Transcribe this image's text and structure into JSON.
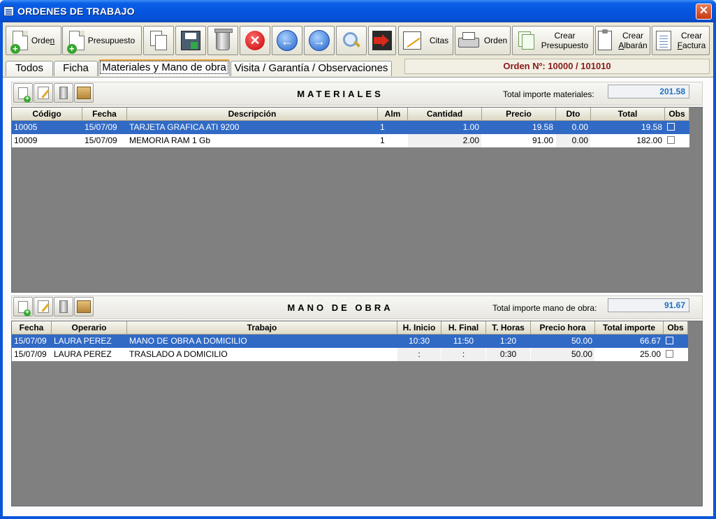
{
  "window": {
    "title": "ORDENES DE TRABAJO"
  },
  "toolbar": {
    "orden_label_pre": "Orde",
    "orden_label_u": "n",
    "presupuesto_label": "Presupuesto",
    "citas_label": "Citas",
    "print_orden_label": "Orden",
    "crear_presupuesto_l1": "Crear",
    "crear_presupuesto_l2": "Presupuesto",
    "crear_albaran_l1": "Crear",
    "crear_albaran_u": "A",
    "crear_albaran_rest": "lbarán",
    "crear_factura_l1": "Crear",
    "crear_factura_u": "F",
    "crear_factura_rest": "actura",
    "icons": [
      "new-order-icon",
      "new-budget-icon",
      "copy-icon",
      "save-icon",
      "trash-icon",
      "cancel-icon",
      "arrow-left-icon",
      "arrow-right-icon",
      "search-icon",
      "exit-icon",
      "calendar-icon",
      "printer-icon",
      "sheets-icon",
      "clipboard-icon",
      "invoice-icon"
    ]
  },
  "tabs": [
    "Todos",
    "Ficha",
    "Materiales y Mano de obra",
    "Visita / Garantía / Observaciones"
  ],
  "active_tab": "Materiales y Mano de obra",
  "order_number": "Orden Nº: 10000 / 101010",
  "materiales": {
    "title": "MATERIALES",
    "total_label": "Total importe materiales:",
    "total_value": "201.58",
    "columns": [
      "Código",
      "Fecha",
      "Descripción",
      "Alm",
      "Cantidad",
      "Precio",
      "Dto",
      "Total",
      "Obs"
    ],
    "rows": [
      {
        "codigo": "10005",
        "fecha": "15/07/09",
        "descripcion": "TARJETA GRAFICA ATI 9200",
        "alm": "1",
        "cantidad": "1.00",
        "precio": "19.58",
        "dto": "0.00",
        "total": "19.58"
      },
      {
        "codigo": "10009",
        "fecha": "15/07/09",
        "descripcion": "MEMORIA RAM 1 Gb",
        "alm": "1",
        "cantidad": "2.00",
        "precio": "91.00",
        "dto": "0.00",
        "total": "182.00"
      }
    ]
  },
  "mano_obra": {
    "title": "MANO DE OBRA",
    "total_label": "Total importe mano de obra:",
    "total_value": "91.67",
    "columns": [
      "Fecha",
      "Operario",
      "Trabajo",
      "H. Inicio",
      "H. Final",
      "T. Horas",
      "Precio hora",
      "Total importe",
      "Obs"
    ],
    "rows": [
      {
        "fecha": "15/07/09",
        "operario": "LAURA PEREZ",
        "trabajo": "MANO DE OBRA A DOMICILIO",
        "inicio": "10:30",
        "final": "11:50",
        "horas": "1:20",
        "precio": "50.00",
        "total": "66.67"
      },
      {
        "fecha": "15/07/09",
        "operario": "LAURA PEREZ",
        "trabajo": "TRASLADO A DOMICILIO",
        "inicio": ":",
        "final": ":",
        "horas": "0:30",
        "precio": "50.00",
        "total": "25.00"
      }
    ]
  },
  "colors": {
    "selection": "#316ac5",
    "order_text": "#8a1a1a",
    "total_text": "#1f70c0",
    "grid_empty": "#808080"
  }
}
